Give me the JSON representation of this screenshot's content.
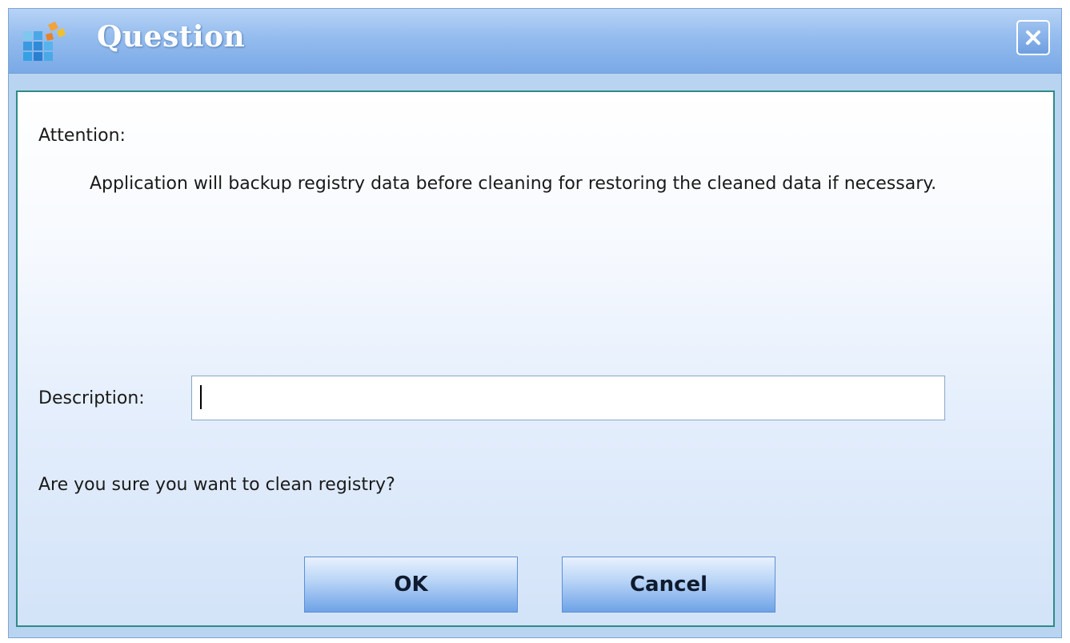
{
  "window": {
    "title": "Question",
    "close_label": "x"
  },
  "dialog": {
    "attention_label": "Attention:",
    "message": "Application will backup registry data before cleaning for restoring the cleaned data if necessary.",
    "description_label": "Description:",
    "description_value": "",
    "confirm_question": "Are you sure you want to clean registry?"
  },
  "buttons": {
    "ok_label": "OK",
    "cancel_label": "Cancel"
  },
  "icons": {
    "app": "registry-cleaner-app-icon",
    "close": "close-icon"
  },
  "colors": {
    "titlebar": "#94bcee",
    "client_border": "#2e8b86",
    "button": "#8fb8ee"
  }
}
